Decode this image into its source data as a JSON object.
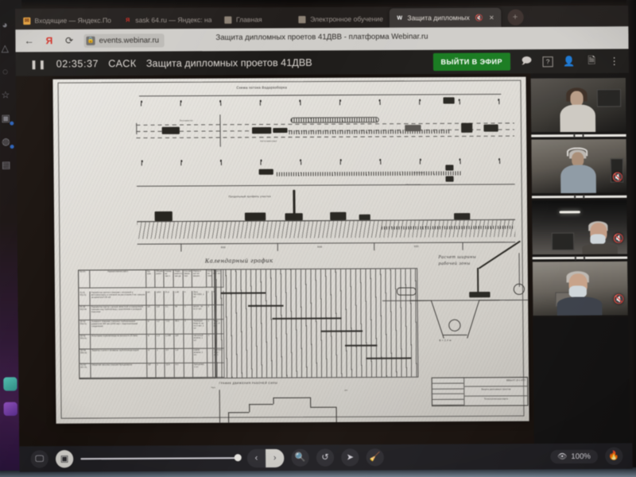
{
  "browser": {
    "tabs": [
      {
        "label": "Входящие — Яндекс.По",
        "favicon": "mail-icon",
        "favicon_color": "#e8a33d",
        "active": false
      },
      {
        "label": "sask 64.ru — Яндекс: на",
        "favicon": "yandex-icon",
        "favicon_color": "#d12d23",
        "active": false
      },
      {
        "label": "Главная",
        "favicon": "site-icon",
        "favicon_color": "#8d8275",
        "active": false
      },
      {
        "label": "Электронное обучение",
        "favicon": "site-icon",
        "favicon_color": "#8d8275",
        "active": false
      },
      {
        "label": "Защита дипломных",
        "favicon": "webinar-icon",
        "favicon_color": "#ffffff",
        "active": true
      }
    ],
    "active_tab_mute_icon": "speaker-muted-icon",
    "active_tab_close_icon": "close-icon",
    "new_tab_label": "+",
    "back_icon": "back-arrow-icon",
    "yandex_icon": "yandex-logo-icon",
    "reload_icon": "reload-icon",
    "lock_icon": "lock-icon",
    "url": "events.webinar.ru",
    "page_title": "Защита дипломных проетов 41ДВВ - платформа Webinar.ru"
  },
  "app_header": {
    "pause_icon": "pause-icon",
    "timer": "02:35:37",
    "organization": "САСК",
    "event_title": "Защита дипломных проетов 41ДВВ",
    "go_live_label": "ВЫЙТИ В ЭФИР",
    "icons": [
      {
        "name": "chat-icon",
        "glyph": "🗩"
      },
      {
        "name": "help-icon",
        "glyph": "?"
      },
      {
        "name": "participants-icon",
        "glyph": "👤"
      },
      {
        "name": "files-icon",
        "glyph": "🗎"
      },
      {
        "name": "more-options-icon",
        "glyph": "⋮"
      }
    ]
  },
  "slide": {
    "sheet_title": "Схема потока Водоразборка",
    "calendar_title": "Календарный график",
    "zone_title_line1": "Расчет ширины",
    "zone_title_line2": "рабочей зоны",
    "labor_chart_title": "ГРАФИК ДВИЖЕНИЯ РАБОЧЕЙ СИЛЫ",
    "calendar_headers": [
      "№ п/п",
      "Наименование работ",
      "Ед. изм.",
      "Объем работ",
      "Норма вр. чел-ч",
      "Трудо- емкость чел-дн",
      "Состав звена чел.",
      "Марка и кол-во машин",
      "Кол-во смен",
      "Продол- жит. дн."
    ],
    "calendar_rows": [
      {
        "no": "01-01 001-01",
        "work": "Разработка грунта в траншее с погрузкой в автосамосвалы и отвозкой на расстояние 3 км. ковшом экскаватора 0,65 м3",
        "unit": "м3",
        "volume": "1450",
        "norm": "25,4",
        "labor": "1,48",
        "crew": "4",
        "machine": "Экск. ЭО-3322, 1 шт.",
        "shifts": "1",
        "days": "8"
      },
      {
        "no": "05-02 003-04",
        "work": "Разработка грунта с ручной зачисткой и планировкой траншеи под трубопровод с креплением и укладкой подсыпки",
        "unit": "м3",
        "volume": "112",
        "norm": "3,1",
        "labor": "9м",
        "crew": "2",
        "machine": "вручн., зв-но 2 чел.",
        "shifts": "2",
        "days": ""
      },
      {
        "no": "22-02 004-01",
        "work": "Укладка в траншею стальных трубопроводов диаметром 400 мм (1000 мм) с гидроизоляцией соединений",
        "unit": "м",
        "volume": "1,2",
        "norm": "7,52",
        "labor": "26,1",
        "crew": "2",
        "machine": "Трубоукл. Кран-4, зв-но 2 чел. 1 шт.",
        "shifts": "1",
        "days": "Кран, авт. с4 (а)"
      },
      {
        "no": "22-01 005-01",
        "work": "Испытание трубопровода на прочность (0,5мм)",
        "unit": "м",
        "volume": "1,2",
        "norm": "1,148",
        "labor": "116",
        "crew": "",
        "machine": "насосный агрегат, 1 шт.",
        "shifts": "1",
        "days": ""
      },
      {
        "no": "22-04 006-02",
        "work": "Заделка стыков и проверка трубопровода водой",
        "unit": "м",
        "volume": "1",
        "norm": "2,5",
        "labor": "1,4",
        "crew": "",
        "machine": "компр. агрегат, 1 шт.",
        "shifts": "",
        "days": "Приемка 4 сут. дн-1"
      },
      {
        "no": "01-02 007-01",
        "work": "Обратная засыпка траншеи бульдозером",
        "unit": "м3",
        "volume": "1",
        "norm": "12,4",
        "labor": "4,5",
        "crew": "",
        "machine": "бульдозер, 1 шт.",
        "shifts": "",
        "days": ""
      }
    ],
    "title_block_fields": [
      "ВВБиУП 15-1-4ПП",
      "Защита дипломных проетов",
      "Чертеж рабочий",
      "Технологическая карта",
      "Лист",
      "Листов",
      "Масса",
      "Масштаб"
    ]
  },
  "videos": {
    "tiles": [
      {
        "name": "participant-tile-1",
        "muted": false
      },
      {
        "name": "participant-tile-2",
        "muted": true,
        "mute_icon": "mic-muted-icon"
      },
      {
        "name": "participant-tile-3",
        "muted": true,
        "mute_icon": "mic-muted-icon"
      },
      {
        "name": "participant-tile-4",
        "muted": true,
        "mute_icon": "mic-muted-icon"
      }
    ]
  },
  "bottom_toolbar": {
    "screen_share_icon": "screen-share-icon",
    "presentation_icon": "presentation-icon",
    "prev_icon": "‹",
    "next_icon": "›",
    "zoom_tool_icon": "magnifier-icon",
    "undo_icon": "undo-icon",
    "pointer_icon": "pointer-icon",
    "eraser_icon": "eraser-icon",
    "visibility_icon": "eye-icon",
    "zoom_level": "100%",
    "flame_icon": "flame-icon"
  },
  "os_dock": {
    "icons": [
      {
        "name": "profile-icon",
        "glyph": "◕"
      },
      {
        "name": "bell-icon",
        "glyph": "🔔"
      },
      {
        "name": "message-icon",
        "glyph": "🗩"
      },
      {
        "name": "star-icon",
        "glyph": "☆"
      },
      {
        "name": "apps-icon",
        "glyph": "🗗",
        "badge": true
      },
      {
        "name": "clock-icon",
        "glyph": "◷",
        "badge": true
      },
      {
        "name": "notes-icon",
        "glyph": "🗒"
      }
    ]
  },
  "colors": {
    "accent_green": "#167a1e",
    "browser_chrome": "#cfcdc9",
    "app_bg": "#1d1b19",
    "mute_red": "#e23b2f"
  }
}
